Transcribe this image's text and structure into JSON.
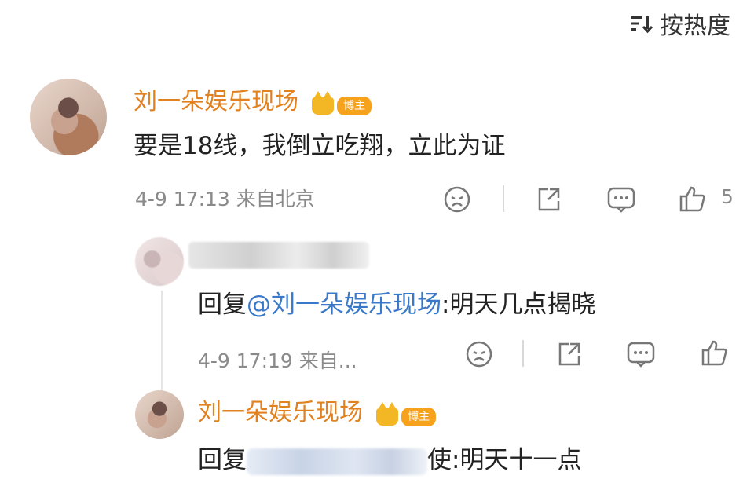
{
  "sort": {
    "label": "按热度",
    "icon": "sort-icon"
  },
  "comment": {
    "username": "刘一朵娱乐现场",
    "badge": "博主",
    "text": "要是18线，我倒立吃翔，立此为证",
    "meta": "4-9 17:13 来自北京",
    "like_count": "5"
  },
  "reply1": {
    "prefix": "回复",
    "mention": "@刘一朵娱乐现场",
    "text": ":明天几点揭晓",
    "meta": "4-9 17:19 来自..."
  },
  "reply2": {
    "username": "刘一朵娱乐现场",
    "badge": "博主",
    "prefix": "回复",
    "suffix": "使",
    "text": ":明天十一点"
  },
  "icons": [
    "sort-icon",
    "crown-icon",
    "sad-face-icon",
    "share-icon",
    "comment-icon",
    "like-icon"
  ]
}
